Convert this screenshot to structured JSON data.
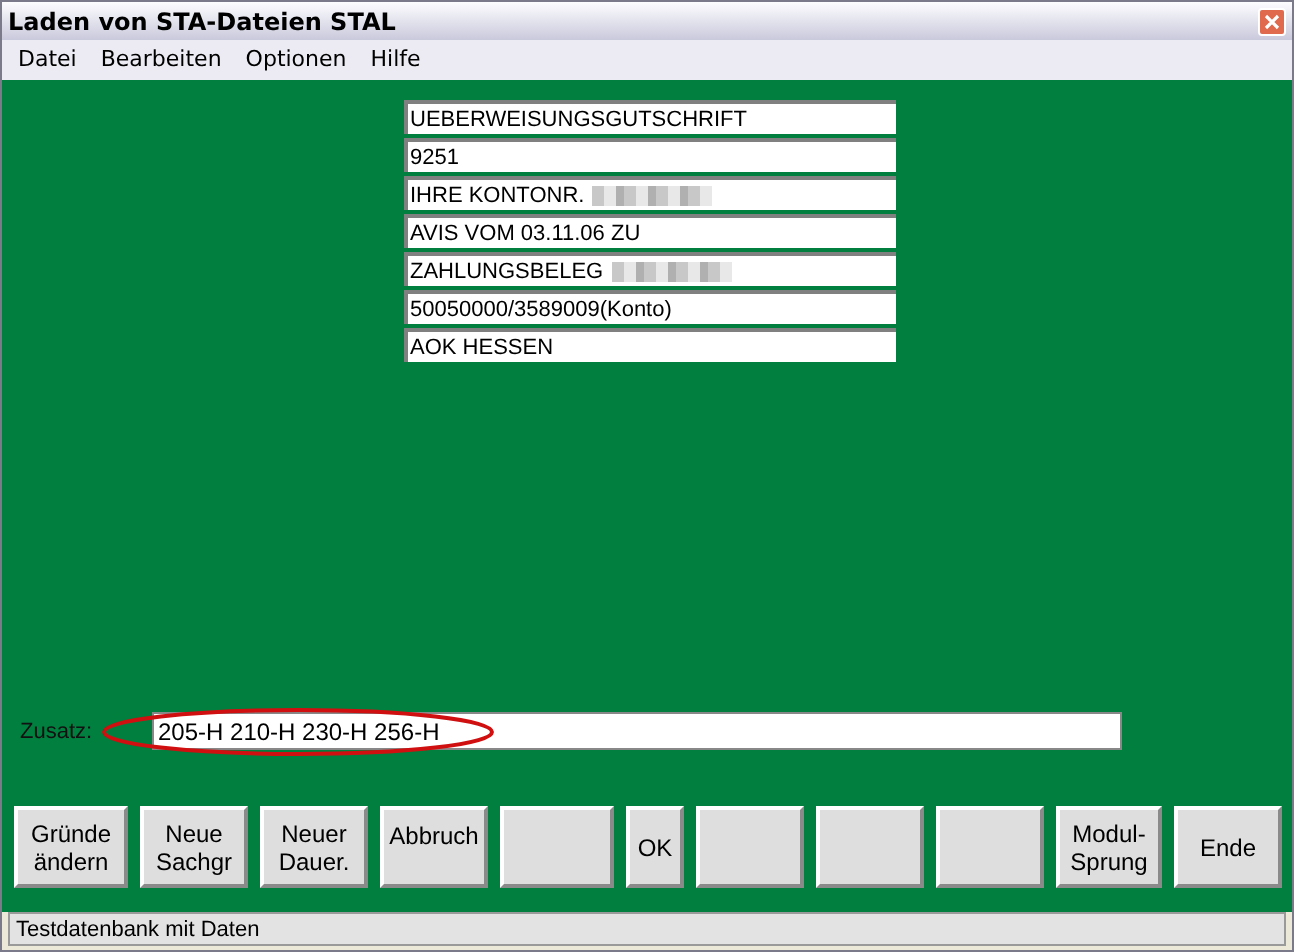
{
  "window": {
    "title": "Laden von STA-Dateien STAL"
  },
  "menu": [
    "Datei",
    "Bearbeiten",
    "Optionen",
    "Hilfe"
  ],
  "fields": [
    {
      "value": "UEBERWEISUNGSGUTSCHRIFT",
      "redacted": false
    },
    {
      "value": "9251",
      "redacted": false
    },
    {
      "value": "IHRE KONTONR.",
      "redacted": true
    },
    {
      "value": "AVIS VOM 03.11.06 ZU",
      "redacted": false
    },
    {
      "value": "ZAHLUNGSBELEG",
      "redacted": true
    },
    {
      "value": "50050000/3589009(Konto)",
      "redacted": false
    },
    {
      "value": "AOK HESSEN",
      "redacted": false
    }
  ],
  "zusatz": {
    "label": "Zusatz:",
    "value": "205-H 210-H 230-H 256-H",
    "highlighted": true
  },
  "buttons": [
    {
      "kind": "text",
      "label": "Gründe\nändern"
    },
    {
      "kind": "text",
      "label": "Neue\nSachgr"
    },
    {
      "kind": "text",
      "label": "Neuer\nDauer."
    },
    {
      "kind": "texttop",
      "label": "Abbruch"
    },
    {
      "kind": "blank"
    },
    {
      "kind": "text",
      "label": "OK"
    },
    {
      "kind": "blank"
    },
    {
      "kind": "blank"
    },
    {
      "kind": "blank"
    },
    {
      "kind": "text",
      "label": "Modul-\nSprung"
    },
    {
      "kind": "text",
      "label": "Ende"
    }
  ],
  "status_bar": "Testdatenbank mit Daten"
}
